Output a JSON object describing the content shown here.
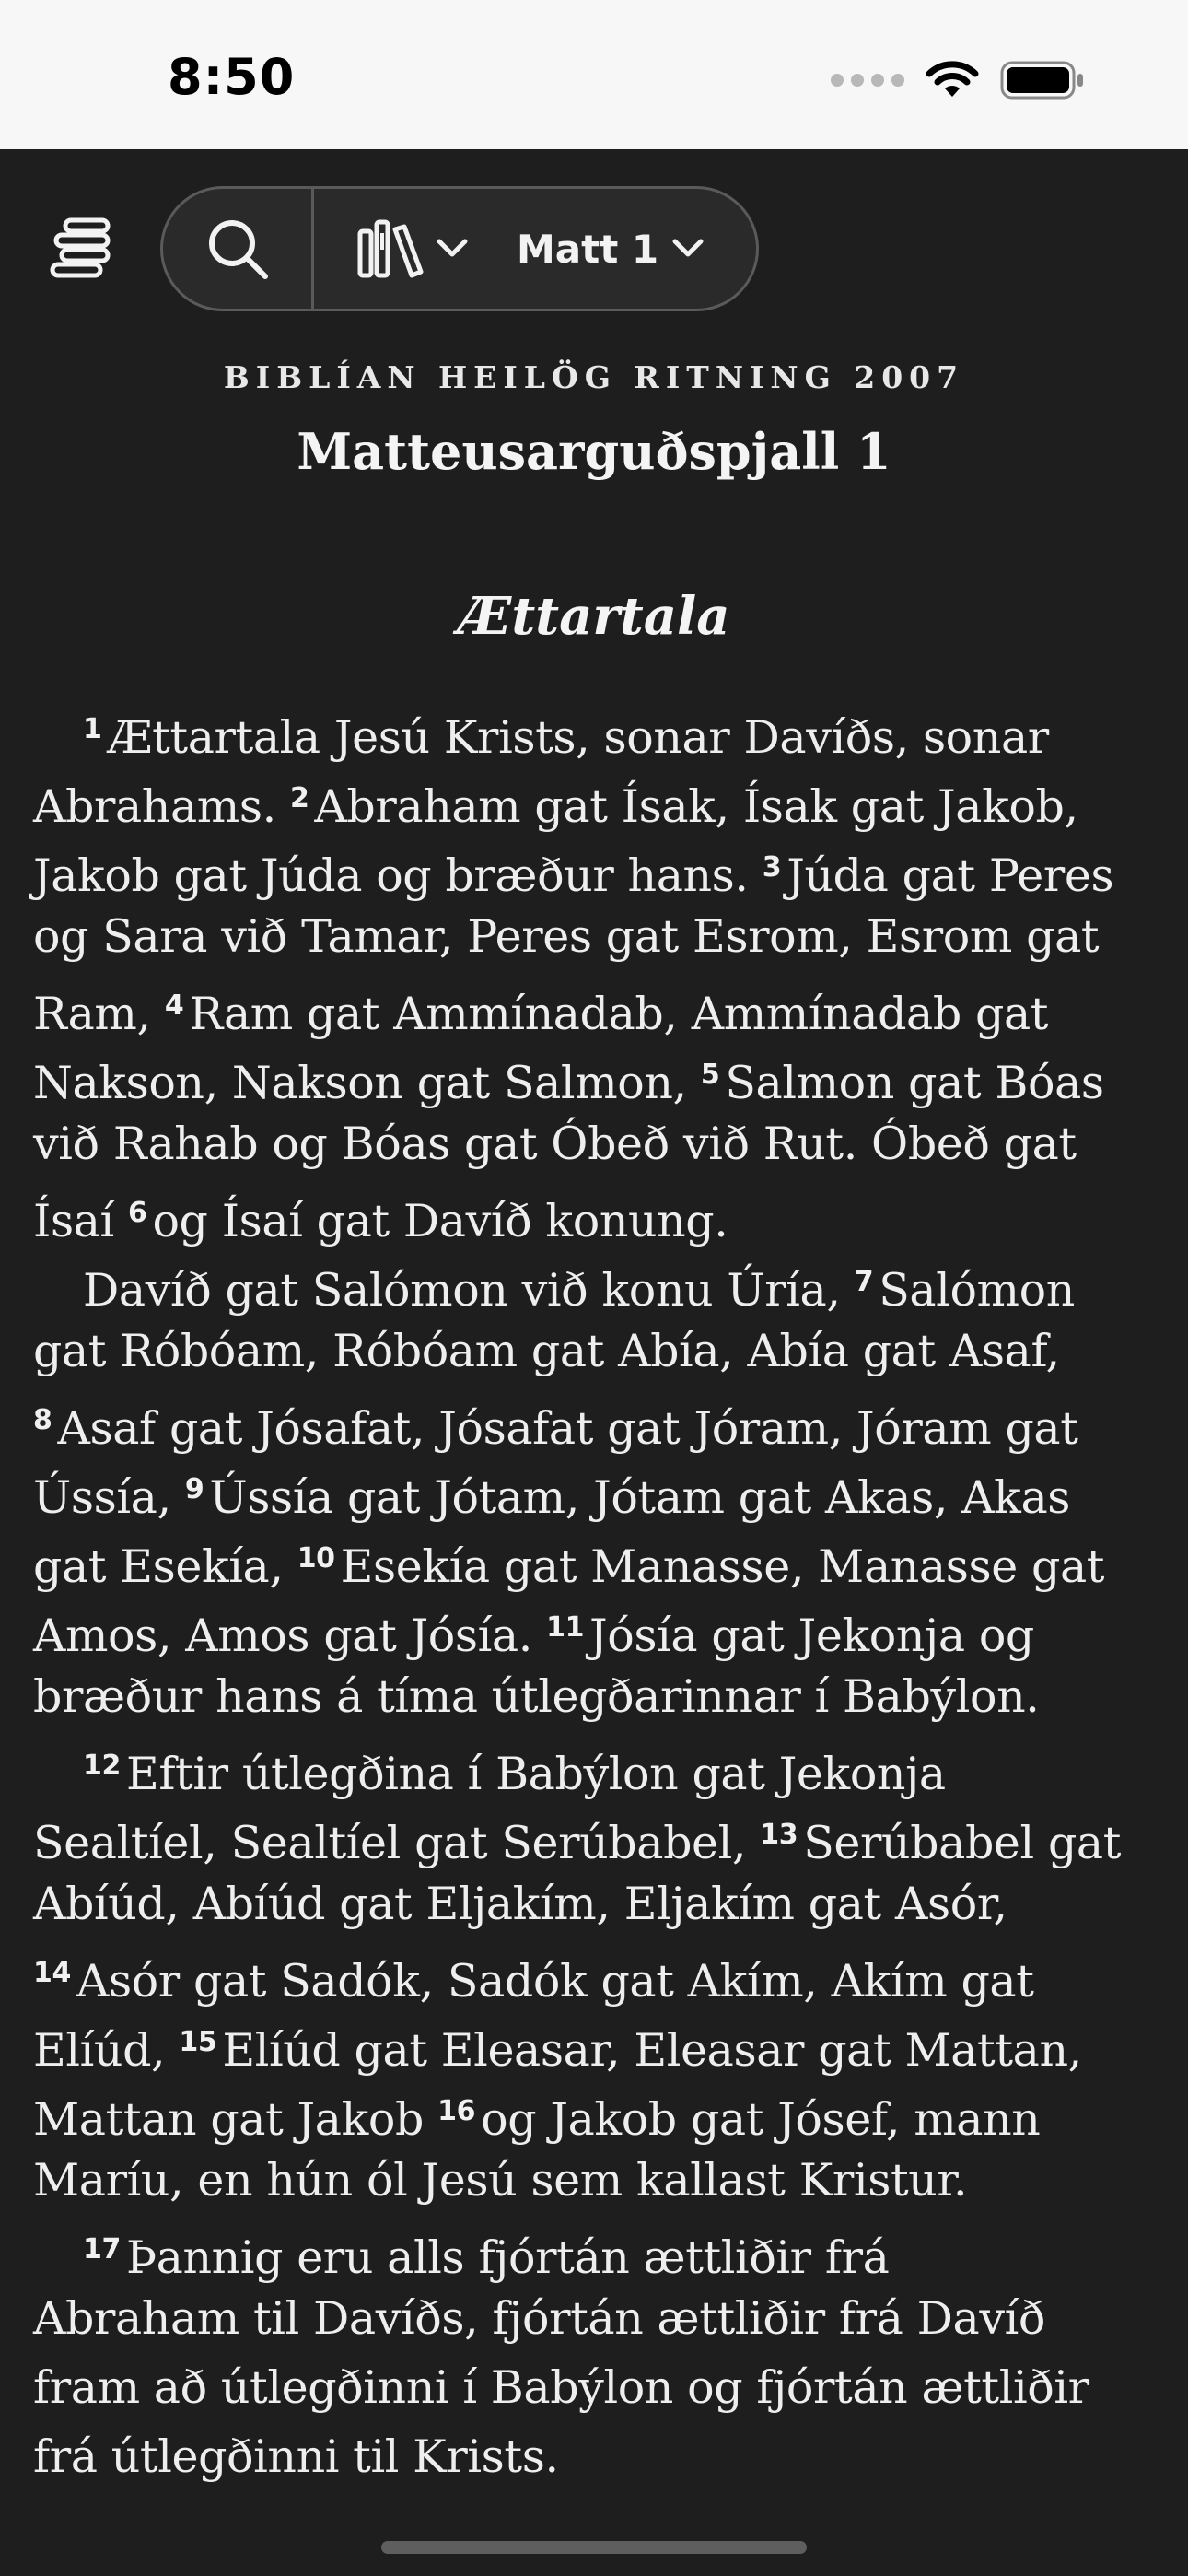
{
  "status_bar": {
    "time": "8:50"
  },
  "toolbar": {
    "book_reference": "Matt 1"
  },
  "header": {
    "version_name": "BIBLÍAN HEILÖG RITNING 2007",
    "chapter_title": "Matteusarguðspjall 1",
    "section_heading": "Ættartala"
  },
  "lines": [
    {
      "indent": true,
      "parts": [
        {
          "v": "1"
        },
        {
          "t": "Ættartala Jesú Krists, sonar Davíðs, sonar"
        }
      ]
    },
    {
      "parts": [
        {
          "t": "Abrahams. "
        },
        {
          "v": "2"
        },
        {
          "t": "Abraham gat Ísak, Ísak gat Jakob,"
        }
      ]
    },
    {
      "parts": [
        {
          "t": "Jakob gat Júda og bræður hans. "
        },
        {
          "v": "3"
        },
        {
          "t": "Júda gat Peres"
        }
      ]
    },
    {
      "parts": [
        {
          "t": "og Sara við Tamar, Peres gat Esrom, Esrom gat"
        }
      ]
    },
    {
      "parts": [
        {
          "t": "Ram, "
        },
        {
          "v": "4"
        },
        {
          "t": "Ram gat Ammínadab, Ammínadab gat"
        }
      ]
    },
    {
      "parts": [
        {
          "t": "Nakson, Nakson gat Salmon, "
        },
        {
          "v": "5"
        },
        {
          "t": "Salmon gat Bóas"
        }
      ]
    },
    {
      "parts": [
        {
          "t": "við Rahab og Bóas gat Óbeð við Rut. Óbeð gat"
        }
      ]
    },
    {
      "parts": [
        {
          "t": "Ísaí "
        },
        {
          "v": "6"
        },
        {
          "t": "og Ísaí gat Davíð konung."
        }
      ]
    },
    {
      "indent": true,
      "parts": [
        {
          "t": "Davíð gat Salómon við konu Úría, "
        },
        {
          "v": "7"
        },
        {
          "t": "Salómon"
        }
      ]
    },
    {
      "parts": [
        {
          "t": "gat Róbóam, Róbóam gat Abía, Abía gat Asaf,"
        }
      ]
    },
    {
      "parts": [
        {
          "v": "8"
        },
        {
          "t": "Asaf gat Jósafat, Jósafat gat Jóram, Jóram gat"
        }
      ]
    },
    {
      "parts": [
        {
          "t": "Ússía, "
        },
        {
          "v": "9"
        },
        {
          "t": "Ússía gat Jótam, Jótam gat Akas, Akas"
        }
      ]
    },
    {
      "parts": [
        {
          "t": "gat Esekía, "
        },
        {
          "v": "10"
        },
        {
          "t": "Esekía gat Manasse, Manasse gat"
        }
      ]
    },
    {
      "parts": [
        {
          "t": "Amos, Amos gat Jósía. "
        },
        {
          "v": "11"
        },
        {
          "t": "Jósía gat Jekonja og"
        }
      ]
    },
    {
      "parts": [
        {
          "t": "bræður hans á tíma útlegðarinnar í Babýlon."
        }
      ]
    },
    {
      "indent": true,
      "parts": [
        {
          "v": "12"
        },
        {
          "t": "Eftir útlegðina í Babýlon gat Jekonja"
        }
      ]
    },
    {
      "parts": [
        {
          "t": "Sealtíel, Sealtíel gat Serúbabel, "
        },
        {
          "v": "13"
        },
        {
          "t": "Serúbabel gat"
        }
      ]
    },
    {
      "parts": [
        {
          "t": "Abíúd, Abíúd gat Eljakím, Eljakím gat Asór,"
        }
      ]
    },
    {
      "parts": [
        {
          "v": "14"
        },
        {
          "t": "Asór gat Sadók, Sadók gat Akím, Akím gat"
        }
      ]
    },
    {
      "parts": [
        {
          "t": "Elíúd, "
        },
        {
          "v": "15"
        },
        {
          "t": "Elíúd gat Eleasar, Eleasar gat Mattan,"
        }
      ]
    },
    {
      "parts": [
        {
          "t": "Mattan gat Jakob "
        },
        {
          "v": "16"
        },
        {
          "t": "og Jakob gat Jósef, mann"
        }
      ]
    },
    {
      "parts": [
        {
          "t": "Maríu, en hún ól Jesú sem kallast Kristur."
        }
      ]
    },
    {
      "indent": true,
      "parts": [
        {
          "v": "17"
        },
        {
          "t": "Þannig eru alls fjórtán ættliðir frá"
        }
      ]
    },
    {
      "parts": [
        {
          "t": "Abraham til Davíðs, fjórtán ættliðir frá Davíð"
        }
      ]
    },
    {
      "parts": [
        {
          "t": "fram að útlegðinni í Babýlon og fjórtán ættliðir"
        }
      ]
    },
    {
      "parts": [
        {
          "t": "frá útlegðinni til Krists."
        }
      ]
    }
  ]
}
